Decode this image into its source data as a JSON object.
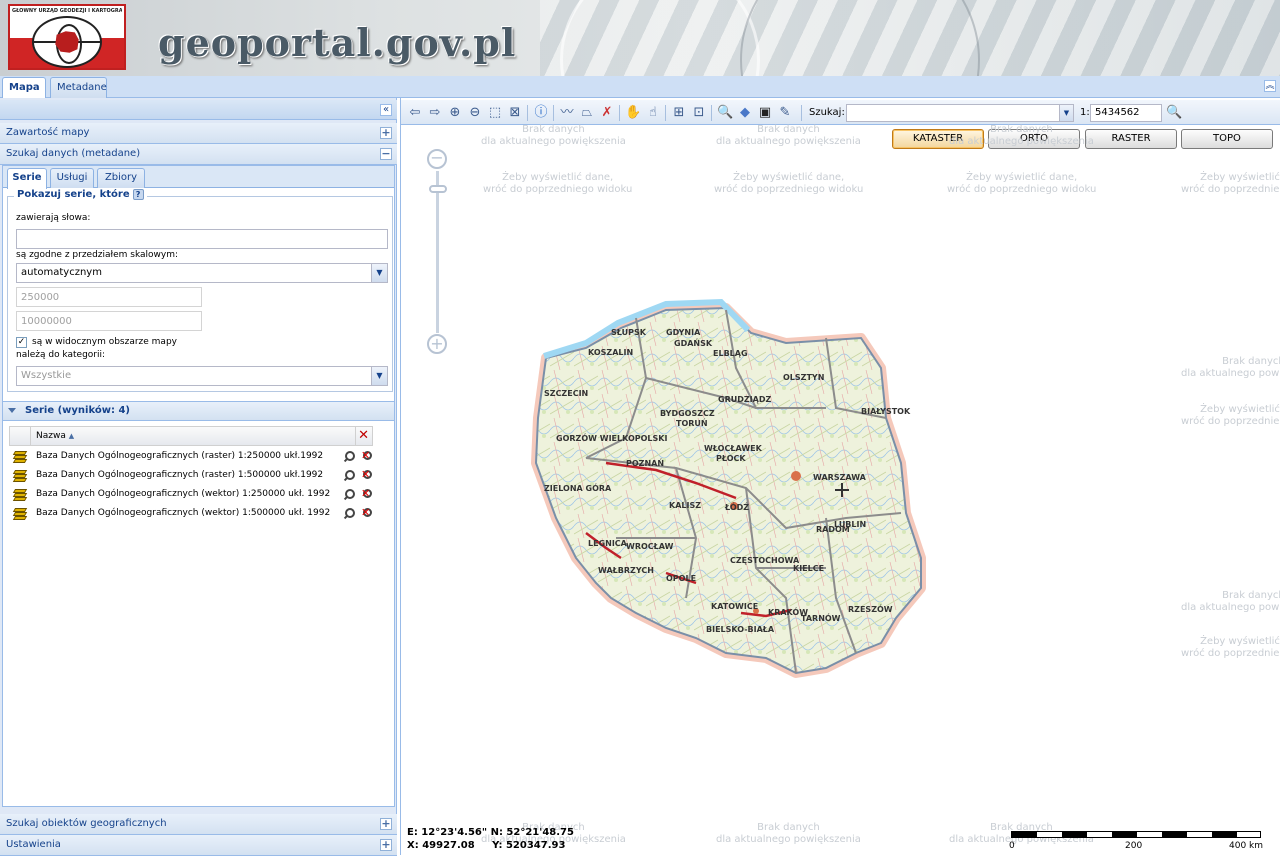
{
  "header": {
    "logo_text": "GŁÓWNY URZĄD GEODEZJI I KARTOGRAFII",
    "site_title": "geoportal.gov.pl"
  },
  "top_tabs": [
    {
      "label": "Mapa",
      "active": true
    },
    {
      "label": "Metadane",
      "active": false
    }
  ],
  "left_panel": {
    "accordion": {
      "map_contents": "Zawartość mapy",
      "search_data": "Szukaj danych (metadane)",
      "search_geo": "Szukaj obiektów geograficznych",
      "settings": "Ustawienia"
    },
    "tabs": [
      {
        "label": "Serie",
        "active": true
      },
      {
        "label": "Usługi",
        "active": false
      },
      {
        "label": "Zbiory",
        "active": false
      }
    ],
    "filter": {
      "legend": "Pokazuj serie, które",
      "help": "?",
      "words_label": "zawierają słowa:",
      "words_value": "",
      "scale_label": "są zgodne z przedziałem skalowym:",
      "scale_mode": "automatycznym",
      "scale_min": "250000",
      "scale_max": "10000000",
      "visible_area_label": "są w widocznym obszarze mapy",
      "visible_area_checked": true,
      "category_label": "należą do kategorii:",
      "category_value": "Wszystkie"
    },
    "results": {
      "title": "Serie (wyników: 4)",
      "column_name": "Nazwa",
      "sort_indicator": "▲",
      "rows": [
        {
          "name": "Baza Danych Ogólnogeograficznych (raster) 1:250000 ukł.1992"
        },
        {
          "name": "Baza Danych Ogólnogeograficznych (raster) 1:500000 ukł.1992"
        },
        {
          "name": "Baza Danych Ogólnogeograficznych (wektor) 1:250000 ukł. 1992"
        },
        {
          "name": "Baza Danych Ogólnogeograficznych (wektor) 1:500000 ukł. 1992"
        }
      ]
    }
  },
  "map": {
    "search_label": "Szukaj:",
    "search_value": "",
    "scale_prefix": "1:",
    "scale_value": "5434562",
    "layers": [
      {
        "label": "KATASTER",
        "active": true
      },
      {
        "label": "ORTO",
        "active": false
      },
      {
        "label": "RASTER",
        "active": false
      },
      {
        "label": "TOPO",
        "active": false
      }
    ],
    "no_data_line1": "Brak danych",
    "no_data_line2": "dla aktualnego powiększenia",
    "back_line1": "Żeby wyświetlić dane,",
    "back_line2": "wróć do poprzedniego widoku",
    "coords_line1": "E: 12°23'4.56\" N: 52°21'48.75",
    "coords_line2": "X: 49927.08     Y: 520347.93",
    "scalebar": {
      "labels": [
        "0",
        "200",
        "400 km"
      ]
    },
    "cities": [
      "SŁUPSK",
      "GDYNIA",
      "GDAŃSK",
      "KOSZALIN",
      "ELBLĄG",
      "OLSZTYN",
      "SZCZECIN",
      "BYDGOSZCZ",
      "TORUŃ",
      "GRUDZIĄDZ",
      "BIAŁYSTOK",
      "GORZÓW WIELKOPOLSKI",
      "WŁOCŁAWEK",
      "PŁOCK",
      "POZNAŃ",
      "WARSZAWA",
      "ZIELONA GÓRA",
      "KALISZ",
      "ŁÓDŹ",
      "RADOM",
      "LUBLIN",
      "LEGNICA",
      "WROCŁAW",
      "CZĘSTOCHOWA",
      "KIELCE",
      "WAŁBRZYCH",
      "OPOLE",
      "KATOWICE",
      "KRAKÓW",
      "TARNÓW",
      "RZESZÓW",
      "BIELSKO-BIAŁA"
    ]
  },
  "colors": {
    "panel_bg": "#dfe8f6",
    "border": "#99bbe8",
    "title_text": "#15428b",
    "active_layer": "#f3d69c"
  }
}
